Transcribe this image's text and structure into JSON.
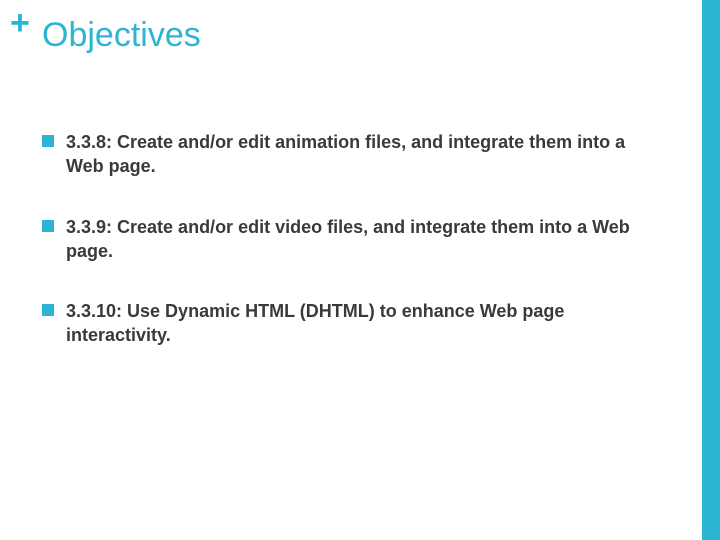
{
  "title": "Objectives",
  "plus_symbol": "+",
  "accent_color": "#2cb5d2",
  "bullets": [
    {
      "text": "3.3.8: Create and/or edit animation files, and integrate them into a Web page."
    },
    {
      "text": "3.3.9: Create and/or edit video files, and integrate them into a Web page."
    },
    {
      "text": "3.3.10: Use Dynamic HTML (DHTML) to enhance Web page interactivity."
    }
  ]
}
